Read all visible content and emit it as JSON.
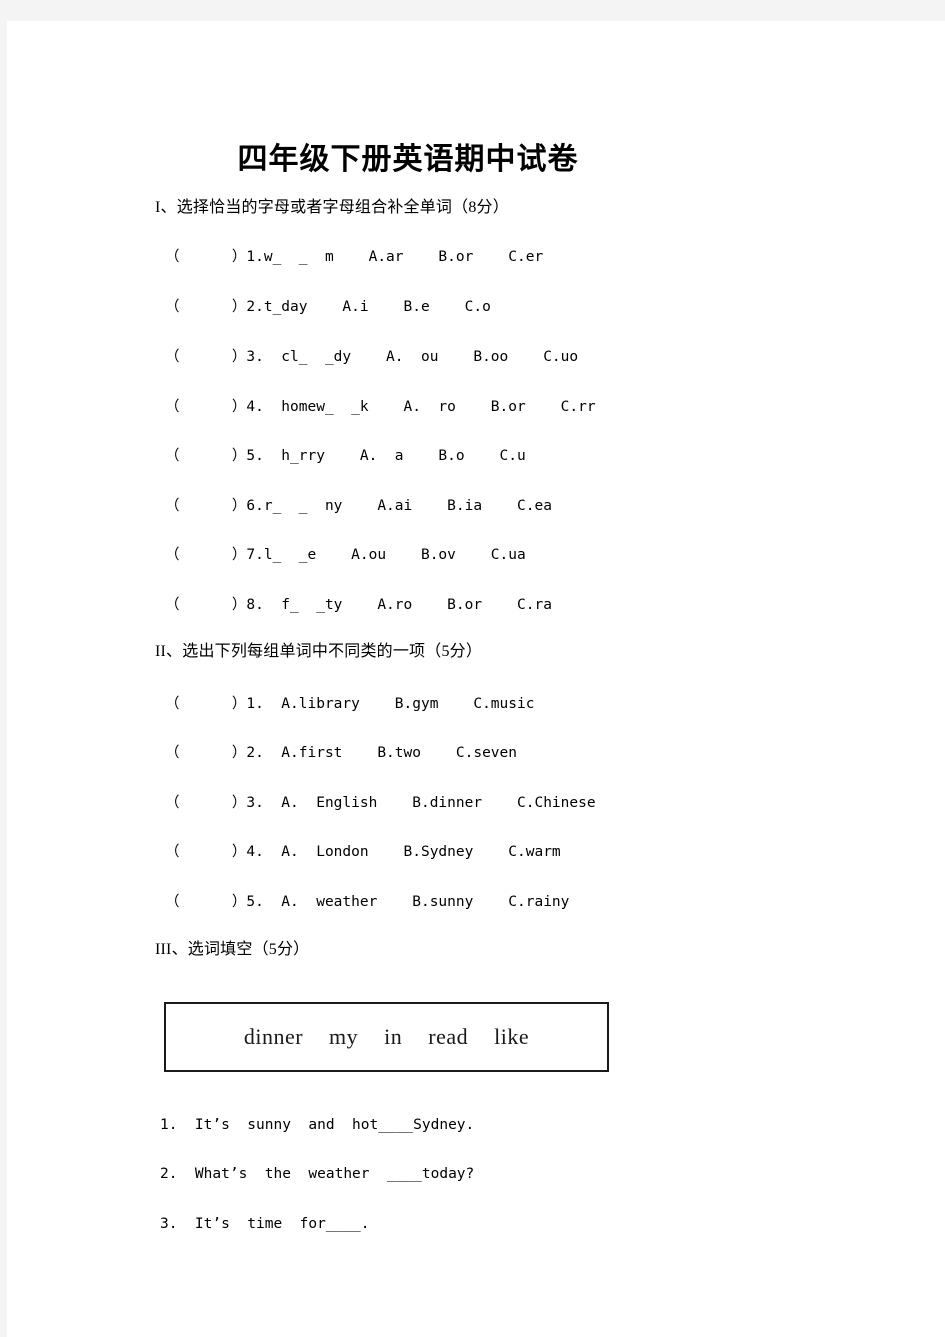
{
  "document": {
    "title": "四年级下册英语期中试卷"
  },
  "sections": [
    {
      "heading": "I、选择恰当的字母或者字母组合补全单词（8分）",
      "questions": [
        "（      ）1.w_  _  m    A.ar    B.or    C.er",
        "（      ）2.t_day    A.i    B.e    C.o",
        "（      ）3.  cl_  _dy    A.  ou    B.oo    C.uo",
        "（      ）4.  homew_  _k    A.  ro    B.or    C.rr",
        "（      ）5.  h_rry    A.  a    B.o    C.u",
        "（      ）6.r_  _  ny    A.ai    B.ia    C.ea",
        "（      ）7.l_  _e    A.ou    B.ov    C.ua",
        "（      ）8.  f_  _ty    A.ro    B.or    C.ra"
      ]
    },
    {
      "heading": "II、选出下列每组单词中不同类的一项（5分）",
      "questions": [
        "（      ）1.  A.library    B.gym    C.music",
        "（      ）2.  A.first    B.two    C.seven",
        "（      ）3.  A.  English    B.dinner    C.Chinese",
        "（      ）4.  A.  London    B.Sydney    C.warm",
        "（      ）5.  A.  weather    B.sunny    C.rainy"
      ]
    },
    {
      "heading": "III、选词填空（5分）",
      "word_bank": [
        "dinner",
        "my",
        "in",
        "read",
        "like"
      ],
      "fill_sentences": [
        "1.  It’s  sunny  and  hot____Sydney.",
        "2.  What’s  the  weather  ____today?",
        "3.  It’s  time  for____."
      ]
    }
  ]
}
